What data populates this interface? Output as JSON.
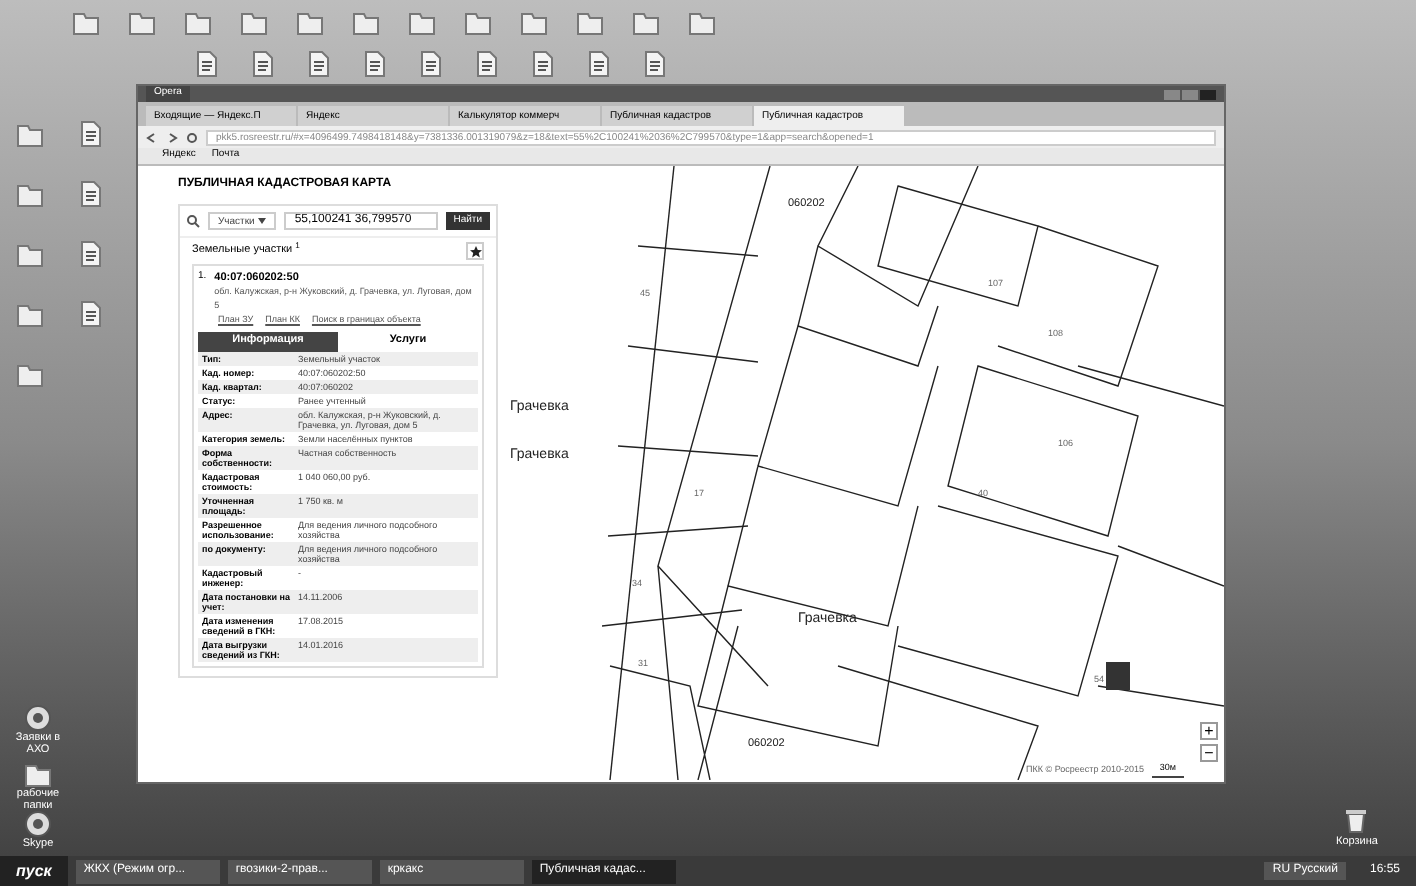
{
  "desktop": {
    "icons": [
      {
        "kind": "folder"
      },
      {
        "kind": "doc"
      }
    ],
    "labeled_icons": [
      {
        "kind": "app",
        "label": "Заявки в АХО"
      },
      {
        "kind": "folder",
        "label": "рабочие папки"
      },
      {
        "kind": "app",
        "label": "Skype"
      }
    ],
    "trash": {
      "label": "Корзина"
    }
  },
  "browser": {
    "title": "Opera",
    "tabs": [
      {
        "label": "Входящие — Яндекс.П",
        "selected": false
      },
      {
        "label": "Яндекс",
        "selected": false
      },
      {
        "label": "Калькулятор коммерч",
        "selected": false
      },
      {
        "label": "Публичная кадастров",
        "selected": false
      },
      {
        "label": "Публичная кадастров",
        "selected": true
      }
    ],
    "address": "pkk5.rosreestr.ru/#x=4096499.7498418148&y=7381336.001319079&z=18&text=55%2C100241%2036%2C799570&type=1&app=search&opened=1",
    "bookmarks": [
      "Яндекс",
      "Почта"
    ]
  },
  "panel": {
    "title": "ПУБЛИЧНАЯ КАДАСТРОВАЯ КАРТА",
    "search_type": "Участки",
    "search_value": "55,100241 36,799570",
    "search_button": "Найти",
    "section": "Земельные участки",
    "count": "1",
    "result": {
      "index": "1.",
      "number": "40:07:060202:50",
      "address": "обл. Калужская, р-н Жуковский, д. Грачевка, ул. Луговая, дом 5",
      "links": [
        "План ЗУ",
        "План КК",
        "Поиск в границах объекта"
      ]
    },
    "tabs": [
      {
        "label": "Информация",
        "selected": true
      },
      {
        "label": "Услуги",
        "selected": false
      }
    ],
    "rows": [
      {
        "label": "Тип:",
        "value": "Земельный участок"
      },
      {
        "label": "Кад. номер:",
        "value": "40:07:060202:50"
      },
      {
        "label": "Кад. квартал:",
        "value": "40:07:060202"
      },
      {
        "label": "Статус:",
        "value": "Ранее учтенный"
      },
      {
        "label": "Адрес:",
        "value": "обл. Калужская, р-н Жуковский, д. Грачевка, ул. Луговая, дом 5"
      },
      {
        "label": "Категория земель:",
        "value": "Земли населённых пунктов"
      },
      {
        "label": "Форма собственности:",
        "value": "Частная собственность"
      },
      {
        "label": "Кадастровая стоимость:",
        "value": "1 040 060,00 руб."
      },
      {
        "label": "Уточненная площадь:",
        "value": "1 750 кв. м"
      },
      {
        "label": "Разрешенное использование:",
        "value": "Для ведения личного подсобного хозяйства"
      },
      {
        "label": "по документу:",
        "value": "Для ведения личного подсобного хозяйства"
      },
      {
        "label": "Кадастровый инженер:",
        "value": "-"
      },
      {
        "label": "Дата постановки на учет:",
        "value": "14.11.2006"
      },
      {
        "label": "Дата изменения сведений в ГКН:",
        "value": "17.08.2015"
      },
      {
        "label": "Дата выгрузки сведений из ГКН:",
        "value": "14.01.2016"
      }
    ]
  },
  "map": {
    "labels": [
      {
        "text": "060202",
        "kind": "quarter"
      },
      {
        "text": "Грачевка",
        "kind": "place"
      },
      {
        "text": "Грачевка",
        "kind": "place"
      },
      {
        "text": "Грачевка",
        "kind": "place"
      },
      {
        "text": "060202",
        "kind": "quarter"
      },
      {
        "text": "45",
        "kind": "parcel"
      },
      {
        "text": "17",
        "kind": "parcel"
      },
      {
        "text": "34",
        "kind": "parcel"
      },
      {
        "text": "31",
        "kind": "parcel"
      },
      {
        "text": "107",
        "kind": "parcel"
      },
      {
        "text": "108",
        "kind": "parcel"
      },
      {
        "text": "106",
        "kind": "parcel"
      },
      {
        "text": "40",
        "kind": "parcel"
      },
      {
        "text": "54",
        "kind": "parcel"
      }
    ],
    "attribution": "ПКК © Росреестр 2010-2015",
    "scale": "30м",
    "zoom_in": "+",
    "zoom_out": "−"
  },
  "taskbar": {
    "start": "пуск",
    "tasks": [
      {
        "label": "ЖКХ (Режим огр...",
        "selected": false
      },
      {
        "label": "гвозики-2-прав...",
        "selected": false
      },
      {
        "label": "кркакс",
        "selected": false
      },
      {
        "label": "Публичная кадас...",
        "selected": true
      }
    ],
    "language": "RU Русский",
    "clock": "16:55"
  }
}
